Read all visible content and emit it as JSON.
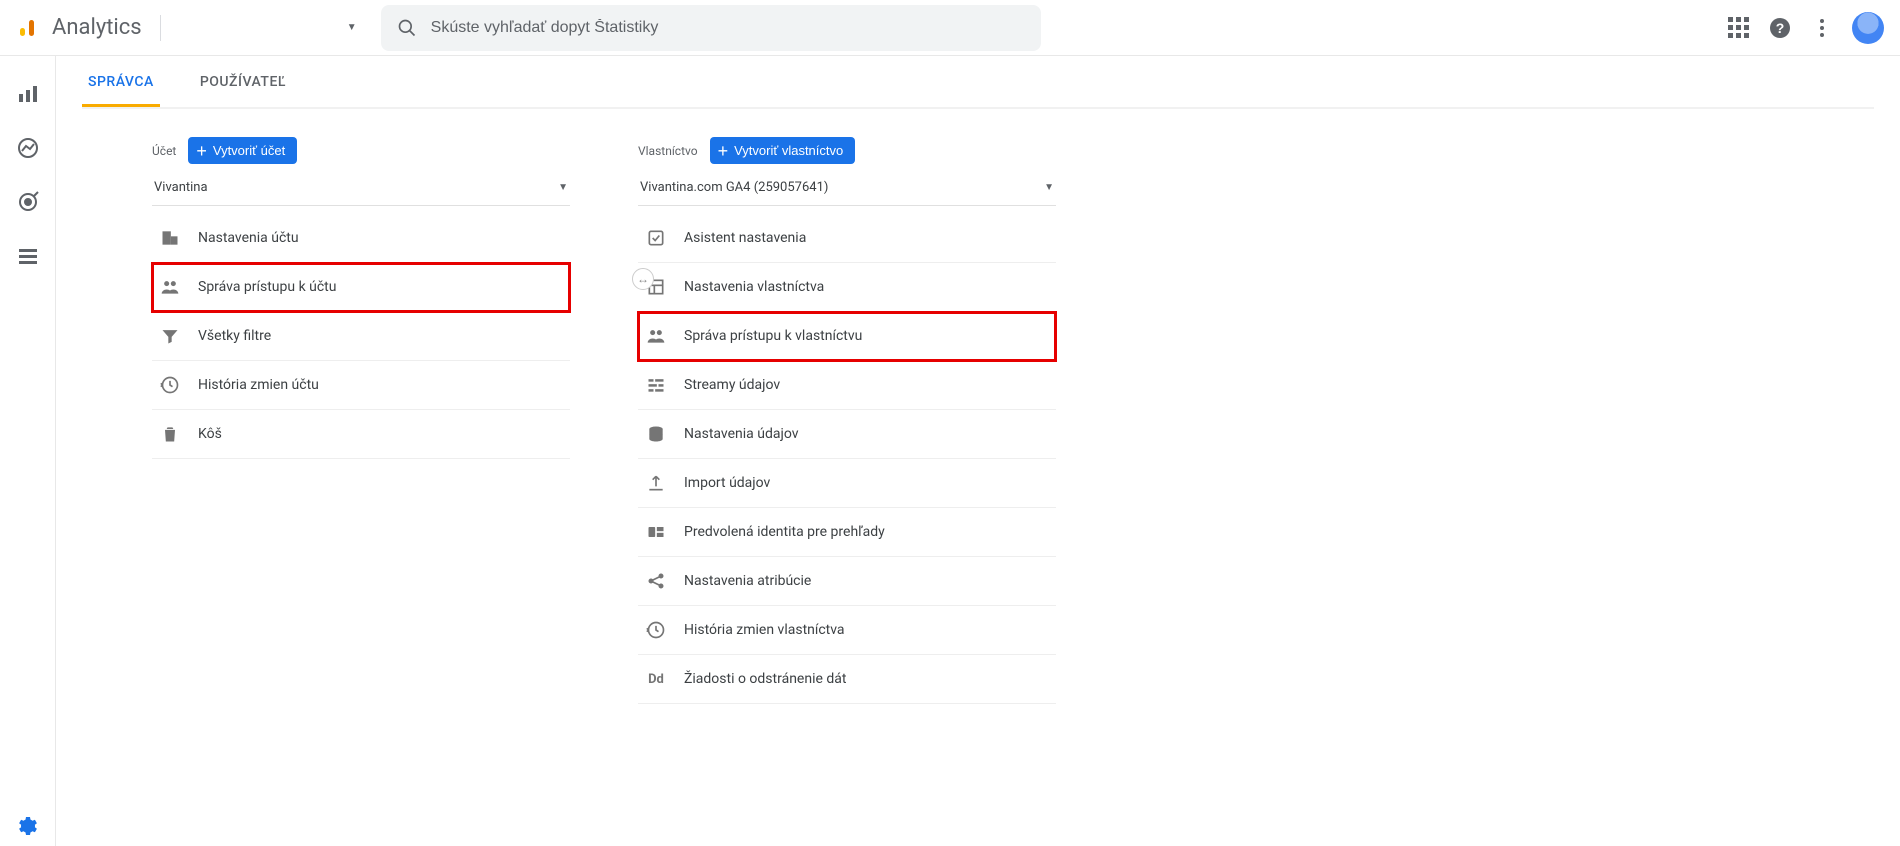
{
  "brand": "Analytics",
  "search": {
    "placeholder": "Skúste vyhľadať dopyt Štatistiky"
  },
  "tabs": [
    {
      "label": "SPRÁVCA",
      "active": true
    },
    {
      "label": "POUŽÍVATEĽ",
      "active": false
    }
  ],
  "account_col": {
    "header": "Účet",
    "create_btn": "Vytvoriť účet",
    "selected": "Vivantina",
    "items": [
      {
        "label": "Nastavenia účtu",
        "icon": "office",
        "highlight": false
      },
      {
        "label": "Správa prístupu k účtu",
        "icon": "people",
        "highlight": true
      },
      {
        "label": "Všetky filtre",
        "icon": "filter",
        "highlight": false
      },
      {
        "label": "História zmien účtu",
        "icon": "history",
        "highlight": false
      },
      {
        "label": "Kôš",
        "icon": "trash",
        "highlight": false
      }
    ]
  },
  "property_col": {
    "header": "Vlastníctvo",
    "create_btn": "Vytvoriť vlastníctvo",
    "selected": "Vivantina.com GA4 (259057641)",
    "items": [
      {
        "label": "Asistent nastavenia",
        "icon": "check",
        "highlight": false
      },
      {
        "label": "Nastavenia vlastníctva",
        "icon": "layout",
        "highlight": false
      },
      {
        "label": "Správa prístupu k vlastníctvu",
        "icon": "people",
        "highlight": true
      },
      {
        "label": "Streamy údajov",
        "icon": "stream",
        "highlight": false
      },
      {
        "label": "Nastavenia údajov",
        "icon": "database",
        "highlight": false
      },
      {
        "label": "Import údajov",
        "icon": "upload",
        "highlight": false
      },
      {
        "label": "Predvolená identita pre prehľady",
        "icon": "identity",
        "highlight": false
      },
      {
        "label": "Nastavenia atribúcie",
        "icon": "attribution",
        "highlight": false
      },
      {
        "label": "História zmien vlastníctva",
        "icon": "history",
        "highlight": false
      },
      {
        "label": "Žiadosti o odstránenie dát",
        "icon": "dd",
        "highlight": false
      }
    ]
  }
}
